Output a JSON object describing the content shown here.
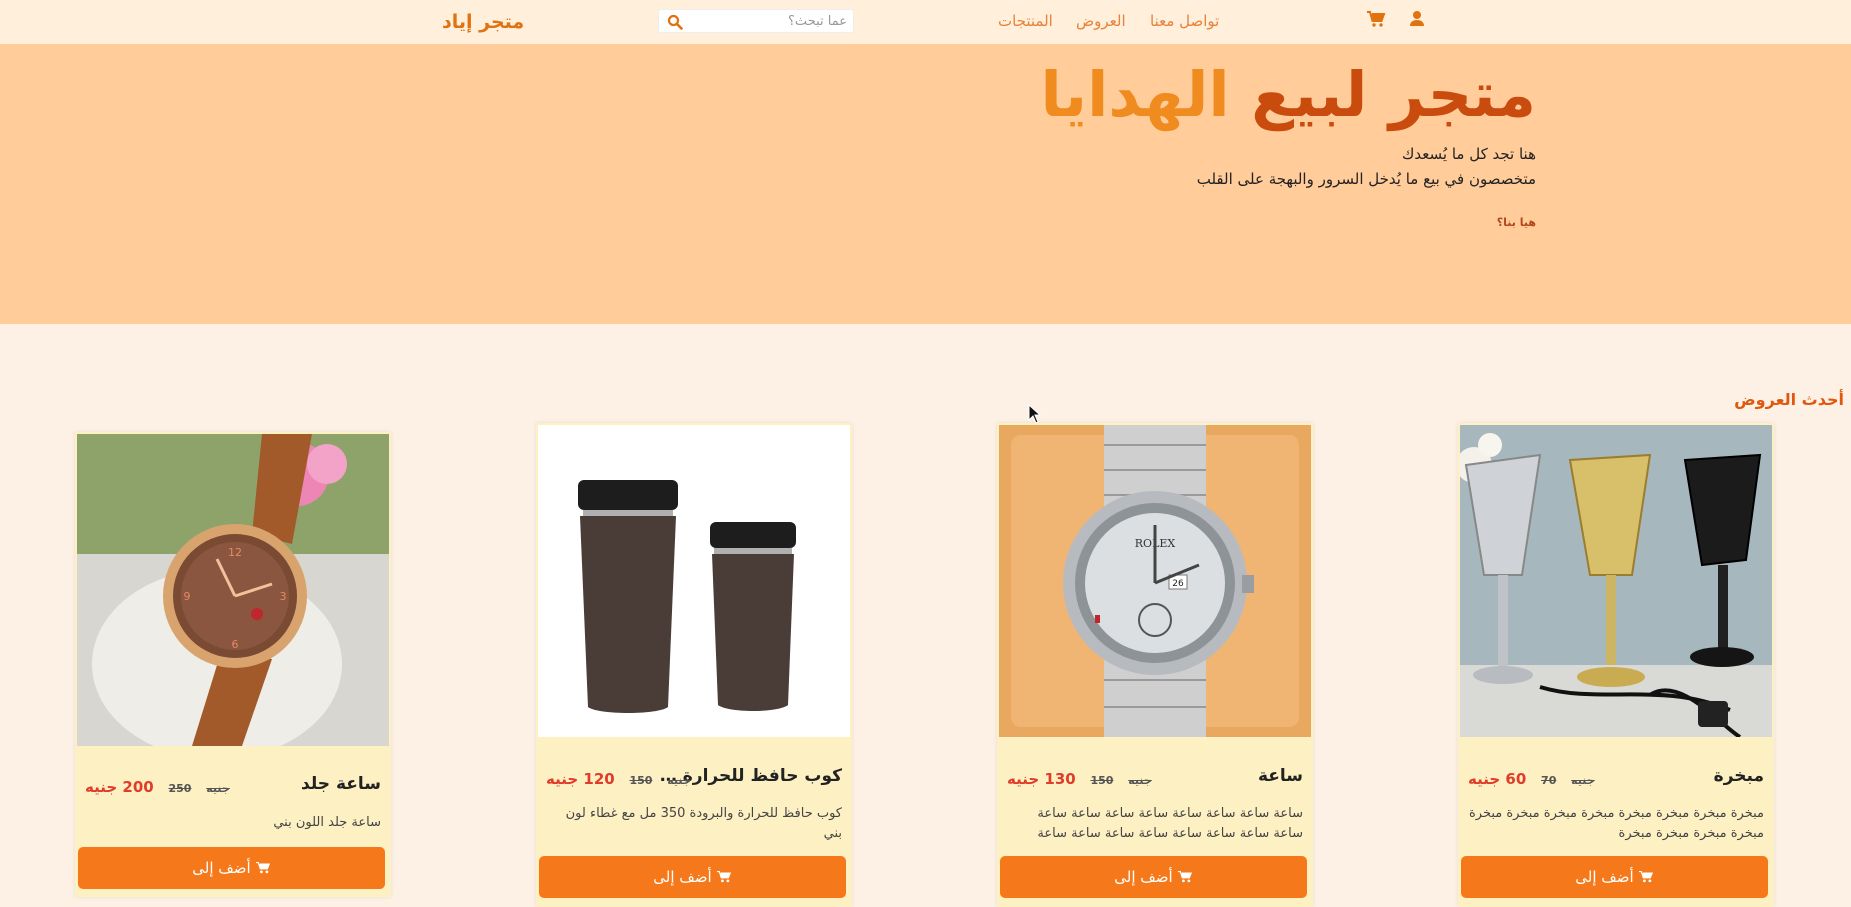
{
  "header": {
    "brand": "متجر إياد",
    "search_placeholder": "عما تبحث؟",
    "nav": {
      "products": "المنتجات",
      "offers": "العروض",
      "contact": "تواصل معنا"
    },
    "icons": [
      "cart-icon",
      "user-icon",
      "search-icon"
    ]
  },
  "hero": {
    "title_part1": "متجر لبيع",
    "title_part2": "الهدايا",
    "line1": "هنا تجد كل ما يُسعدك",
    "line2": "متخصصون في بيع ما يُدخل السرور والبهجة على القلب",
    "cta": "هيا بنا؟"
  },
  "section": {
    "title": "أحدث العروض"
  },
  "products": [
    {
      "name": "مبخرة",
      "price_new": "60 جنيه",
      "price_old": "70",
      "old_unit": "جنيه",
      "desc": "مبخرة مبخرة مبخرة مبخرة مبخرة مبخرة مبخرة مبخرة مبخرة مبخرة مبخرة مبخرة",
      "button": "أضف إلى"
    },
    {
      "name": "ساعة",
      "price_new": "130 جنيه",
      "price_old": "150",
      "old_unit": "جنيه",
      "desc": "ساعة ساعة ساعة ساعة ساعة ساعة ساعة ساعة ساعة ساعة ساعة ساعة ساعة ساعة ساعة ساعة ساعة",
      "button": "أضف إلى"
    },
    {
      "name": "كوب حافظ للحرارة والبرودة",
      "price_new": "120 جنيه",
      "price_old": "150",
      "old_unit": "جنيه",
      "desc": "كوب حافظ للحرارة والبرودة 350 مل مع غطاء لون بني",
      "button": "أضف إلى"
    },
    {
      "name": "ساعة جلد",
      "price_new": "200 جنيه",
      "price_old": "250",
      "old_unit": "جنيه",
      "desc": "ساعة جلد اللون بني",
      "button": "أضف إلى"
    }
  ],
  "colors": {
    "brand": "#e0720f",
    "hero_bg": "#ffcc9a",
    "button": "#f5791b",
    "price": "#e03c2a"
  }
}
